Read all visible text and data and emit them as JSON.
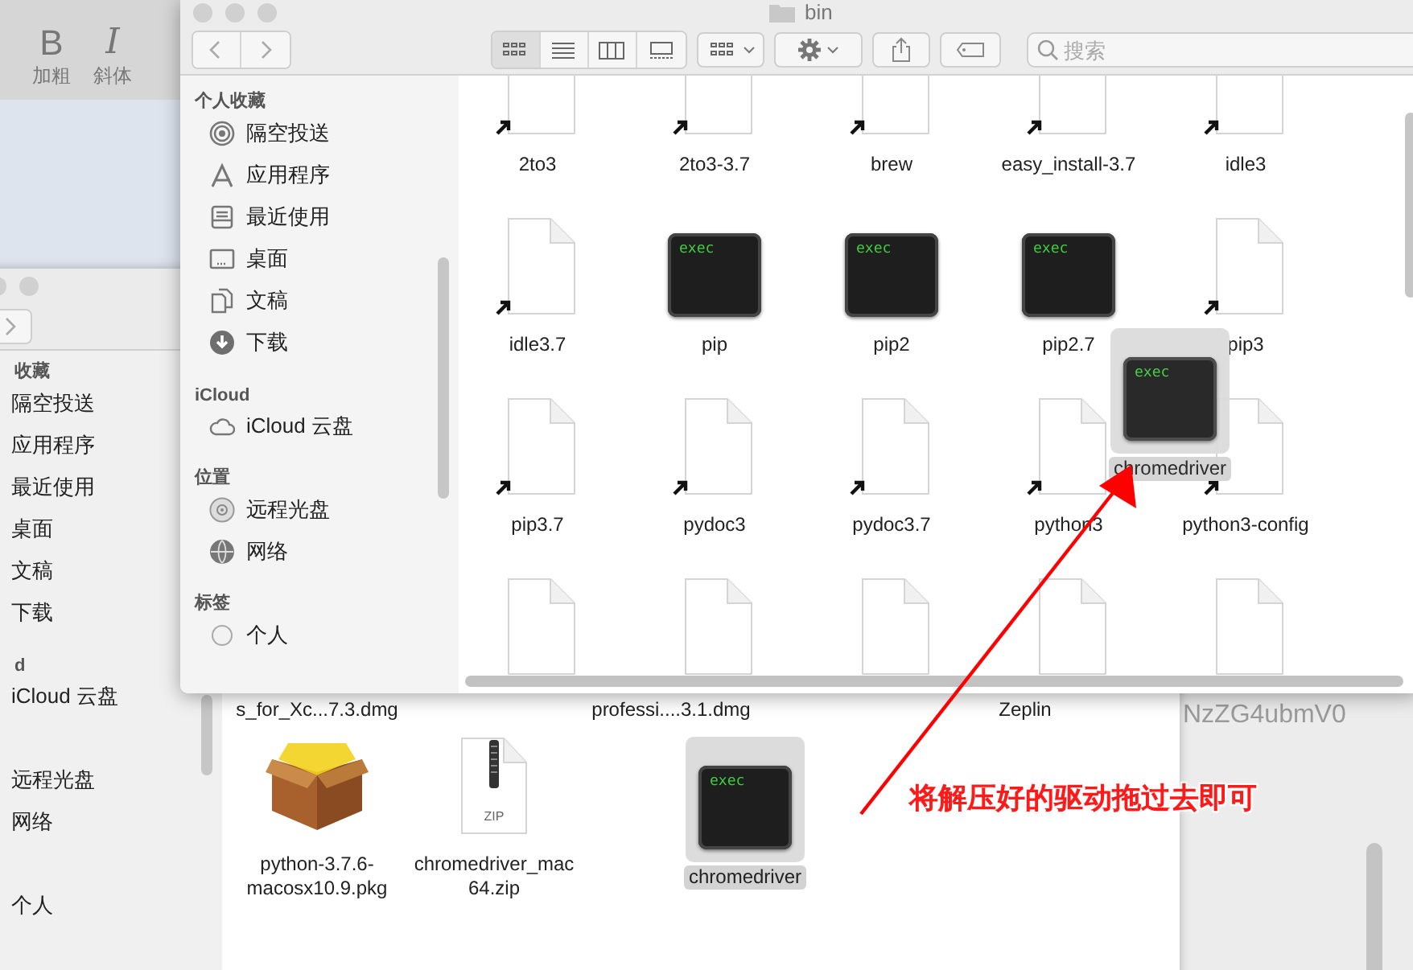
{
  "editor_window": {
    "toolbar": [
      {
        "kind": "bold",
        "glyph": "B",
        "label": "加粗"
      },
      {
        "kind": "italic",
        "glyph": "I",
        "label": "斜体"
      }
    ]
  },
  "right_window": {
    "text": "NzZG4ubmV0"
  },
  "back_finder": {
    "sidebar": [
      {
        "heading": "收藏",
        "items": [
          "隔空投送",
          "应用程序",
          "最近使用",
          "桌面",
          "文稿",
          "下载"
        ]
      },
      {
        "heading": "d",
        "items": [
          "iCloud 云盘"
        ]
      },
      {
        "items": [
          "远程光盘",
          "网络"
        ]
      },
      {
        "items": [
          "个人"
        ]
      }
    ],
    "cut_captions": [
      "s_for_Xc...7.3.dmg",
      "professi....3.1.dmg",
      "Zeplin"
    ],
    "files": [
      {
        "name": "python-3.7.6-macosx10.9.pkg",
        "kind": "package",
        "selected": false
      },
      {
        "name": "chromedriver_mac64.zip",
        "kind": "zip",
        "badge": "ZIP",
        "selected": false
      },
      {
        "name": "chromedriver",
        "kind": "exec",
        "badge": "exec",
        "selected": true
      }
    ]
  },
  "front_finder": {
    "title": "bin",
    "view_buttons": [
      {
        "kind": "icons",
        "selected": true
      },
      {
        "kind": "list",
        "selected": false
      },
      {
        "kind": "columns",
        "selected": false
      },
      {
        "kind": "gallery",
        "selected": false
      }
    ],
    "search": {
      "placeholder": "搜索"
    },
    "sidebar": [
      {
        "heading": "个人收藏",
        "items": [
          {
            "label": "隔空投送",
            "kind": "airdrop"
          },
          {
            "label": "应用程序",
            "kind": "apps"
          },
          {
            "label": "最近使用",
            "kind": "recents"
          },
          {
            "label": "桌面",
            "kind": "desktop"
          },
          {
            "label": "文稿",
            "kind": "documents"
          },
          {
            "label": "下载",
            "kind": "downloads"
          }
        ]
      },
      {
        "heading": "iCloud",
        "items": [
          {
            "label": "iCloud 云盘",
            "kind": "cloud"
          }
        ]
      },
      {
        "heading": "位置",
        "items": [
          {
            "label": "远程光盘",
            "kind": "disc"
          },
          {
            "label": "网络",
            "kind": "network"
          }
        ]
      },
      {
        "heading": "标签",
        "items": [
          {
            "label": "个人",
            "kind": "tag"
          }
        ]
      }
    ],
    "files": [
      {
        "name": "2to3",
        "kind": "alias"
      },
      {
        "name": "2to3-3.7",
        "kind": "alias"
      },
      {
        "name": "brew",
        "kind": "alias"
      },
      {
        "name": "easy_install-3.7",
        "kind": "alias"
      },
      {
        "name": "idle3",
        "kind": "alias"
      },
      {
        "name": "idle3.7",
        "kind": "alias"
      },
      {
        "name": "pip",
        "kind": "exec",
        "badge": "exec"
      },
      {
        "name": "pip2",
        "kind": "exec",
        "badge": "exec"
      },
      {
        "name": "pip2.7",
        "kind": "exec",
        "badge": "exec"
      },
      {
        "name": "pip3",
        "kind": "alias"
      },
      {
        "name": "pip3.7",
        "kind": "alias"
      },
      {
        "name": "pydoc3",
        "kind": "alias"
      },
      {
        "name": "pydoc3.7",
        "kind": "alias"
      },
      {
        "name": "python3",
        "kind": "alias"
      },
      {
        "name": "python3-config",
        "kind": "alias"
      },
      {
        "kind": "document"
      },
      {
        "kind": "document"
      },
      {
        "kind": "document"
      },
      {
        "kind": "document"
      },
      {
        "kind": "document"
      }
    ],
    "drag_ghost": {
      "name": "chromedriver",
      "kind": "exec",
      "badge": "exec",
      "selected": true
    }
  },
  "annotation": {
    "text": "将解压好的驱动拖过去即可"
  }
}
